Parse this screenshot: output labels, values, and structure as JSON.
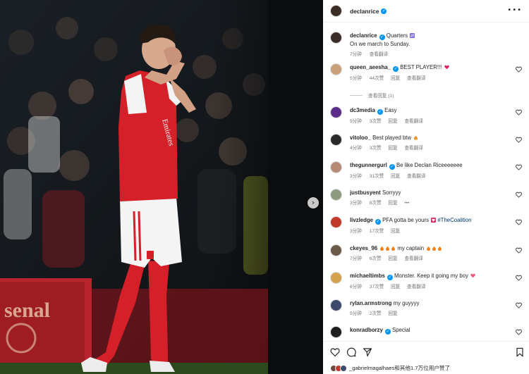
{
  "post": {
    "author": "declanrice",
    "caption_tag": "Quarters",
    "caption_line2": "On we march to Sunday.",
    "caption_time": "7分钟",
    "caption_translate": "查看翻译",
    "likes_text": "_gabrielmagalhaes和其他1.7万位用户赞了"
  },
  "photo": {
    "jersey_text": "Emirates",
    "banner_text": "senal"
  },
  "labels": {
    "reply": "回复",
    "translate": "查看翻译",
    "view_replies": "查看回复 (1)"
  },
  "comments": [
    {
      "user": "queen_aeesha_",
      "verified": true,
      "text": "BEST PLAYER!!!",
      "emoji": "red-heart",
      "time": "5分钟",
      "likes": "44次赞",
      "reply": true,
      "translate": true,
      "avatar_color": "#c9a07a"
    },
    {
      "user": "dc3media",
      "verified": true,
      "text": "Easy",
      "time": "5分钟",
      "likes": "3次赞",
      "reply": true,
      "translate": true,
      "avatar_color": "#5b2c8a"
    },
    {
      "user": "vitoloo_",
      "verified": false,
      "text": "Best played btw",
      "emoji": "fire",
      "time": "4分钟",
      "likes": "3次赞",
      "reply": true,
      "translate": true,
      "avatar_color": "#2a2a2a"
    },
    {
      "user": "thegunnergurl",
      "verified": true,
      "text": "Be like Declan Riceeeeeee",
      "time": "3分钟",
      "likes": "31次赞",
      "reply": true,
      "translate": true,
      "avatar_color": "#b78a76"
    },
    {
      "user": "justbusyent",
      "verified": false,
      "text": "Sorryyy",
      "time": "3分钟",
      "likes": "8次赞",
      "reply": true,
      "more": "•••",
      "avatar_color": "#8f9a7e"
    },
    {
      "user": "livzledge",
      "verified": true,
      "text": "PFA gotta be yours",
      "tag": "#TheCoalition",
      "time": "3分钟",
      "likes": "17次赞",
      "reply": true,
      "avatar_color": "#c0392b"
    },
    {
      "user": "ckeyes_96",
      "verified": false,
      "text": "my captain",
      "time": "7分钟",
      "likes": "6次赞",
      "reply": true,
      "translate": true,
      "avatar_color": "#6b5a48"
    },
    {
      "user": "michaeltimbs",
      "verified": true,
      "text": "Monster. Keep it going my boy",
      "emoji": "pink-heart",
      "time": "6分钟",
      "likes": "37次赞",
      "reply": true,
      "translate": true,
      "avatar_color": "#d4a24e"
    },
    {
      "user": "rylan.armstrong",
      "verified": false,
      "text": "my guyyyy",
      "time": "5分钟",
      "likes": "2次赞",
      "reply": true,
      "avatar_color": "#3c4a6b"
    },
    {
      "user": "konradborzy",
      "verified": true,
      "text": "Special",
      "time": "",
      "likes": "",
      "reply": false,
      "avatar_color": "#1e1e1e"
    }
  ],
  "colors": {
    "verified": "#0095f6",
    "arsenal_red": "#d5202a",
    "muted": "#737373",
    "link": "#00376b"
  },
  "icons": [
    "more-icon",
    "heart-icon",
    "comment-icon",
    "share-icon",
    "bookmark-icon",
    "chevron-right-icon",
    "verified-icon"
  ]
}
